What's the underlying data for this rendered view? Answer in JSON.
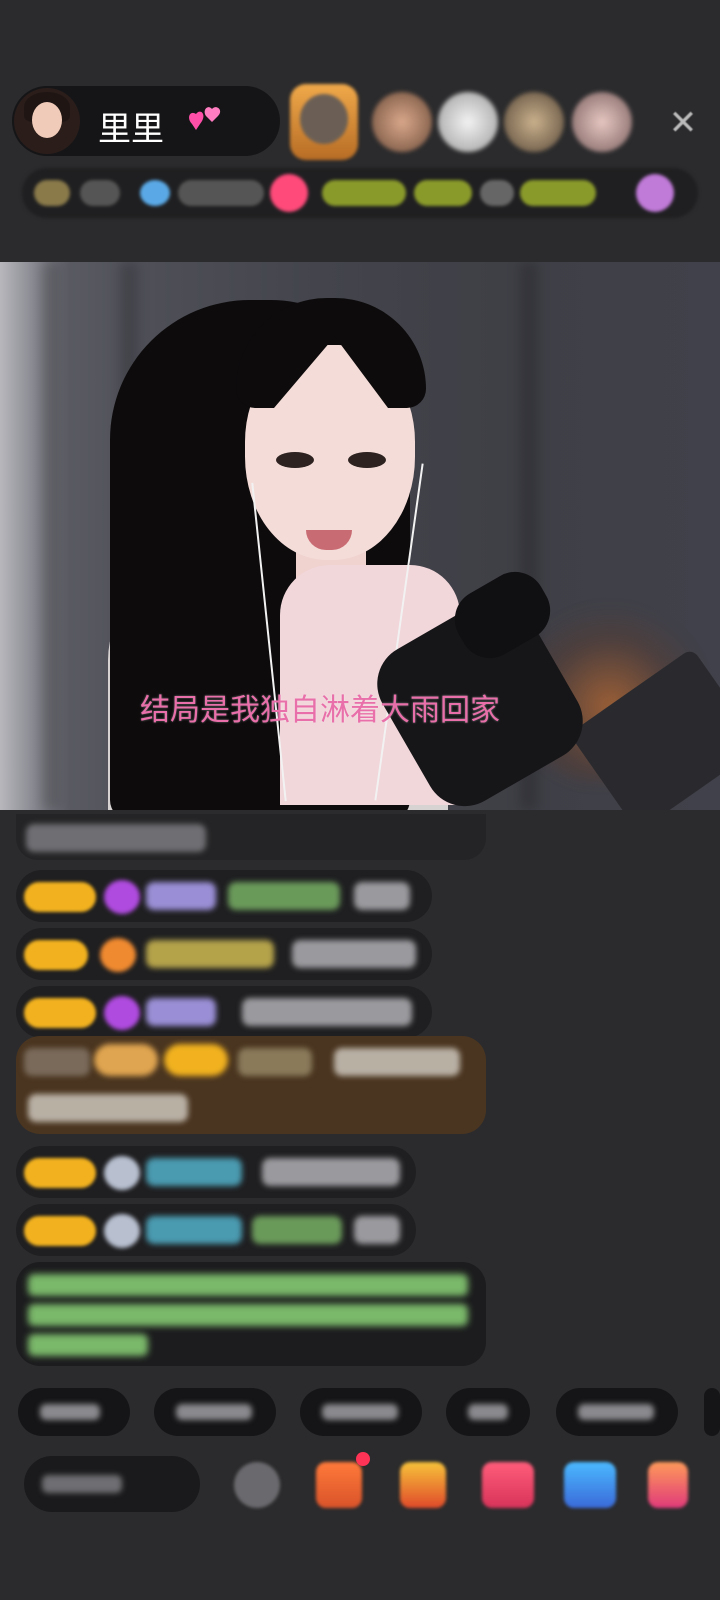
{
  "host": {
    "name": "里里",
    "name_emoji": "💕"
  },
  "header": {
    "close_glyph": "✕"
  },
  "video": {
    "subtitle": "结局是我独自淋着大雨回家"
  },
  "icons": {
    "close": "close-icon",
    "heart": "two-hearts-icon",
    "gift": "gift-icon",
    "emoji": "emoji-icon"
  },
  "colors": {
    "background": "#2b2b2d",
    "subtitle": "#e86fa9",
    "badge": "#f2b21f",
    "gift_line": "#4a3520"
  }
}
